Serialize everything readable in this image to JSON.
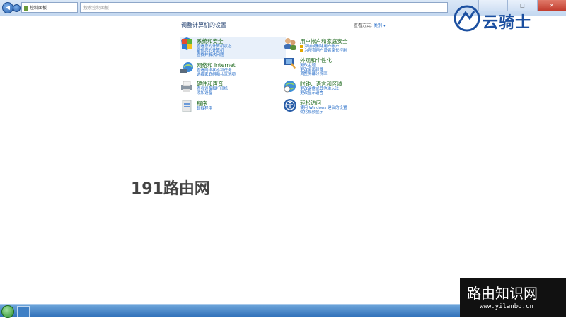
{
  "window": {
    "address_text": "控制面板",
    "search_placeholder": "搜索控制面板",
    "min_label": "—",
    "max_label": "□",
    "close_label": "✕"
  },
  "header": {
    "title": "调整计算机的设置",
    "view_by_label": "查看方式:",
    "view_by_value": "类别 ▾"
  },
  "categories": [
    {
      "title": "系统和安全",
      "links": [
        "查看您的计算机状态",
        "备份您的计算机",
        "查找并解决问题"
      ],
      "icon": "shield-icon"
    },
    {
      "title": "网络和 Internet",
      "links": [
        "查看网络状态和任务",
        "选择家庭组和共享选项"
      ],
      "icon": "network-icon"
    },
    {
      "title": "硬件和声音",
      "links": [
        "查看设备和打印机",
        "添加设备"
      ],
      "icon": "printer-icon"
    },
    {
      "title": "程序",
      "links": [
        "卸载程序"
      ],
      "icon": "programs-icon"
    },
    {
      "title": "用户帐户和家庭安全",
      "links": [
        "添加或删除用户帐户",
        "为所有用户设置家长控制"
      ],
      "icon": "users-icon"
    },
    {
      "title": "外观和个性化",
      "links": [
        "更改主题",
        "更改桌面背景",
        "调整屏幕分辨率"
      ],
      "icon": "appearance-icon"
    },
    {
      "title": "时钟、语言和区域",
      "links": [
        "更改键盘或其他输入法",
        "更改显示语言"
      ],
      "icon": "clock-globe-icon"
    },
    {
      "title": "轻松访问",
      "links": [
        "使用 Windows 建议的设置",
        "优化视频显示"
      ],
      "icon": "ease-of-access-icon"
    }
  ],
  "watermarks": {
    "logo_text": "云骑士",
    "left_text": "191路由网",
    "right_big": "路由知识网",
    "right_small": "www.yilanbo.cn"
  },
  "colors": {
    "category_title": "#1f6a1f",
    "link": "#2a6fc9",
    "titlebar": "#c4d8f0"
  }
}
